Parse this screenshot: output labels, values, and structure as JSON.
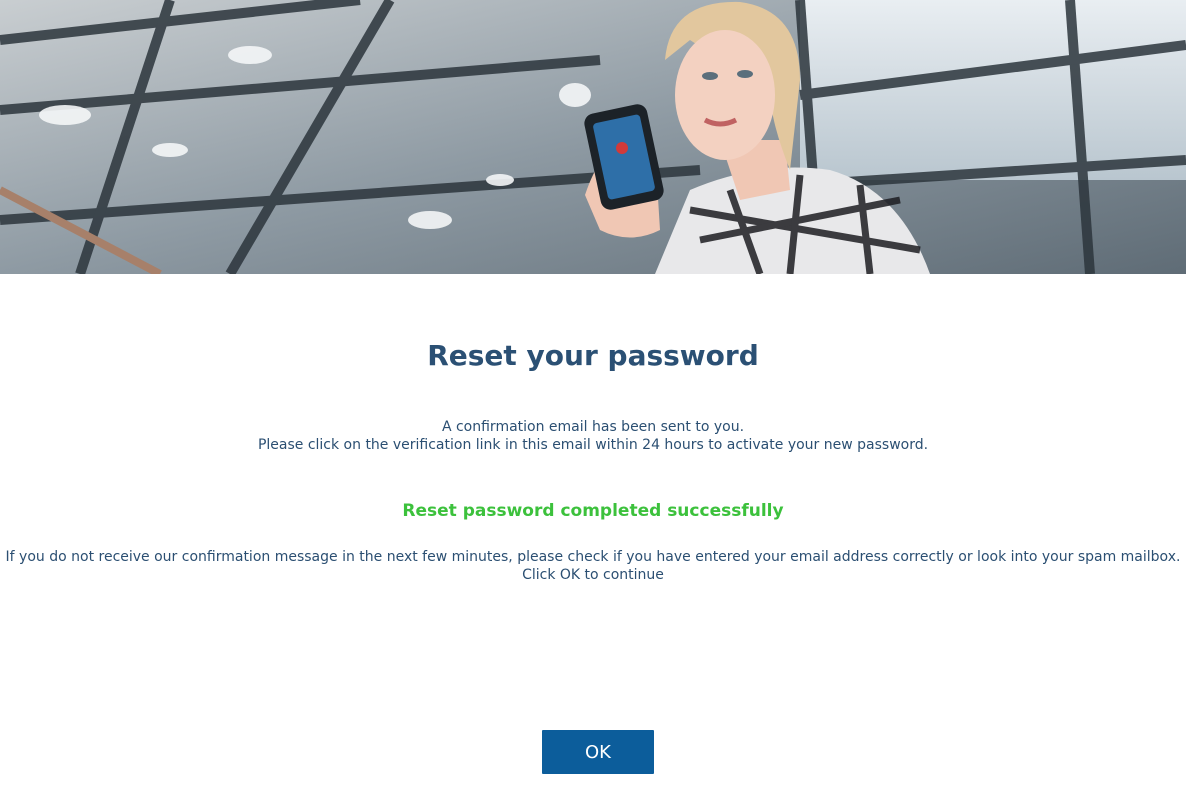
{
  "hero": {
    "image": "woman-holding-smartphone-photo"
  },
  "heading": {
    "title": "Reset your password"
  },
  "info": {
    "line1": "A confirmation email has been sent to you.",
    "line2": "Please click on the verification link in this email within 24 hours to activate your new password."
  },
  "status": {
    "success_message": "Reset password completed successfully"
  },
  "note": {
    "line1": "If you do not receive our confirmation message in the next few minutes, please check if you have entered your email address correctly or look into your spam mailbox.",
    "line2": "Click OK to continue"
  },
  "actions": {
    "ok_label": "OK"
  },
  "colors": {
    "title": "#2b5074",
    "text": "#2b4f72",
    "success": "#3cc13c",
    "button": "#0c5d9b"
  }
}
